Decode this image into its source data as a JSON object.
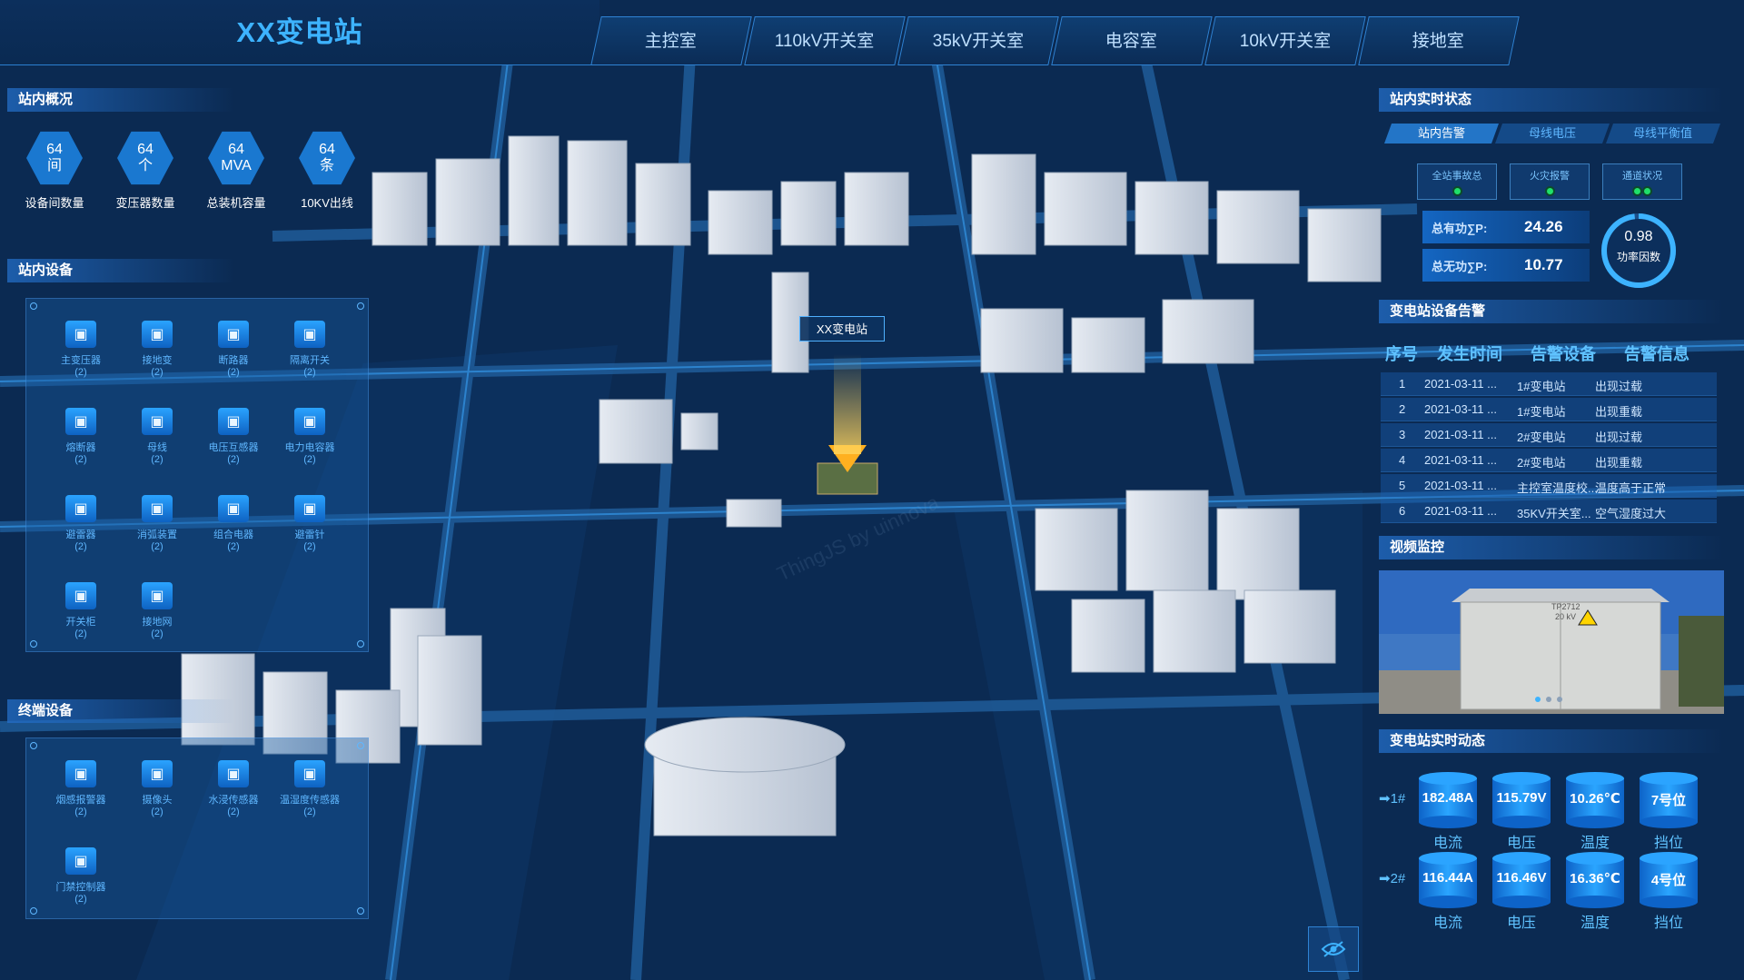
{
  "app": {
    "title": "XX变电站"
  },
  "tabs": [
    "主控室",
    "110kV开关室",
    "35kV开关室",
    "电容室",
    "10kV开关室",
    "接地室"
  ],
  "map": {
    "station_label": "XX变电站"
  },
  "overview": {
    "title": "站内概况",
    "items": [
      {
        "value": "64",
        "unit": "间",
        "label": "设备间数量"
      },
      {
        "value": "64",
        "unit": "个",
        "label": "变压器数量"
      },
      {
        "value": "64",
        "unit": "MVA",
        "label": "总装机容量"
      },
      {
        "value": "64",
        "unit": "条",
        "label": "10KV出线"
      }
    ]
  },
  "station_devices": {
    "title": "站内设备",
    "items": [
      {
        "name": "主变压器",
        "count": "(2)",
        "icon": "transformer-icon"
      },
      {
        "name": "接地变",
        "count": "(2)",
        "icon": "grounding-transformer-icon"
      },
      {
        "name": "断路器",
        "count": "(2)",
        "icon": "breaker-icon"
      },
      {
        "name": "隔离开关",
        "count": "(2)",
        "icon": "disconnector-icon"
      },
      {
        "name": "熔断器",
        "count": "(2)",
        "icon": "fuse-icon"
      },
      {
        "name": "母线",
        "count": "(2)",
        "icon": "busbar-icon"
      },
      {
        "name": "电压互感器",
        "count": "(2)",
        "icon": "voltage-transformer-icon"
      },
      {
        "name": "电力电容器",
        "count": "(2)",
        "icon": "capacitor-icon"
      },
      {
        "name": "避雷器",
        "count": "(2)",
        "icon": "arrester-icon"
      },
      {
        "name": "消弧装置",
        "count": "(2)",
        "icon": "arc-suppression-icon"
      },
      {
        "name": "组合电器",
        "count": "(2)",
        "icon": "gis-icon"
      },
      {
        "name": "避雷针",
        "count": "(2)",
        "icon": "lightning-rod-icon"
      },
      {
        "name": "开关柜",
        "count": "(2)",
        "icon": "switchgear-icon"
      },
      {
        "name": "接地网",
        "count": "(2)",
        "icon": "grounding-grid-icon"
      }
    ]
  },
  "terminal_devices": {
    "title": "终端设备",
    "items": [
      {
        "name": "烟感报警器",
        "count": "(2)",
        "icon": "smoke-detector-icon"
      },
      {
        "name": "摄像头",
        "count": "(2)",
        "icon": "camera-icon"
      },
      {
        "name": "水浸传感器",
        "count": "(2)",
        "icon": "water-sensor-icon"
      },
      {
        "name": "温湿度传感器",
        "count": "(2)",
        "icon": "temp-humidity-sensor-icon"
      },
      {
        "name": "门禁控制器",
        "count": "(2)",
        "icon": "access-controller-icon"
      }
    ]
  },
  "realtime": {
    "title": "站内实时状态",
    "subtabs": [
      "站内告警",
      "母线电压",
      "母线平衡值"
    ],
    "status": [
      {
        "label": "全站事故总"
      },
      {
        "label": "火灾报警"
      },
      {
        "label": "通道状况"
      }
    ],
    "power": [
      {
        "label": "总有功∑P:",
        "value": "24.26"
      },
      {
        "label": "总无功∑P:",
        "value": "10.77"
      }
    ],
    "gauge": {
      "value": "0.98",
      "label": "功率因数",
      "fraction": 0.98
    }
  },
  "alarms": {
    "title": "变电站设备告警",
    "headers": [
      "序号",
      "发生时间",
      "告警设备",
      "告警信息"
    ],
    "rows": [
      [
        "1",
        "2021-03-11 ...",
        "1#变电站",
        "出现过载"
      ],
      [
        "2",
        "2021-03-11 ...",
        "1#变电站",
        "出现重载"
      ],
      [
        "3",
        "2021-03-11 ...",
        "2#变电站",
        "出现过载"
      ],
      [
        "4",
        "2021-03-11 ...",
        "2#变电站",
        "出现重载"
      ],
      [
        "5",
        "2021-03-11 ...",
        "主控室温度校...",
        "温度高于正常"
      ],
      [
        "6",
        "2021-03-11 ...",
        "35KV开关室...",
        "空气湿度过大"
      ]
    ]
  },
  "video": {
    "title": "视频监控",
    "sign_line1": "TP2712",
    "sign_line2": "20 kV"
  },
  "dynamics": {
    "title": "变电站实时动态",
    "labels": [
      "电流",
      "电压",
      "温度",
      "挡位"
    ],
    "rows": [
      {
        "name": "➡1#",
        "values": [
          "182.48A",
          "115.79V",
          "10.26℃",
          "7号位"
        ]
      },
      {
        "name": "➡2#",
        "values": [
          "116.44A",
          "116.46V",
          "16.36℃",
          "4号位"
        ]
      }
    ]
  },
  "colors": {
    "accent": "#3db3ff",
    "panel": "#1a5a9a",
    "ok": "#1fe06a",
    "warn": "#ffb020"
  }
}
